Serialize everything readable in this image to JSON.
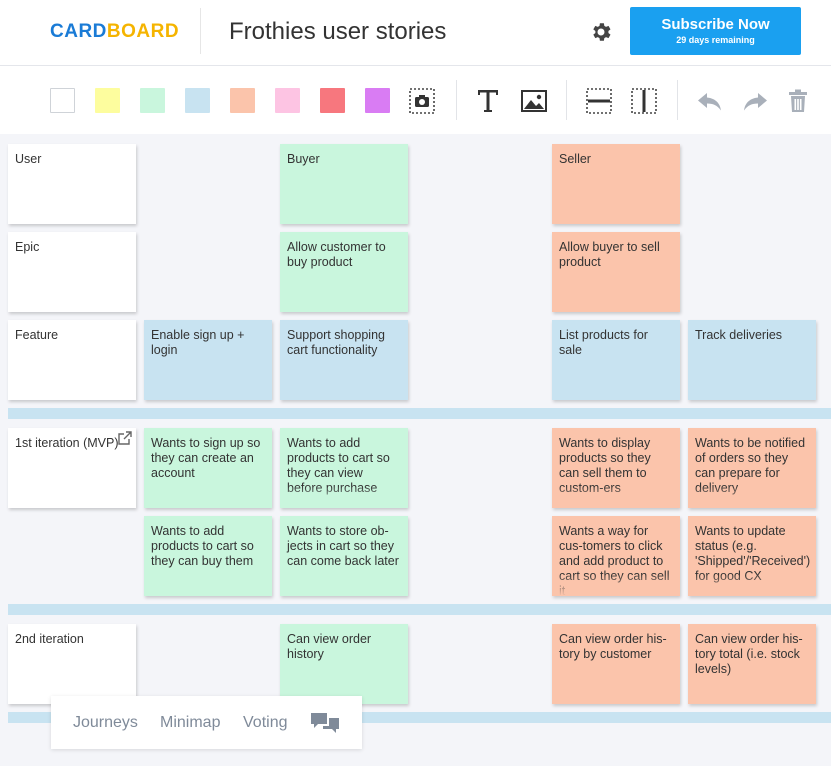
{
  "app": {
    "logo_part1": "CARD",
    "logo_part2": "BOARD",
    "board_title": "Frothies user stories",
    "subscribe_label": "Subscribe Now",
    "subscribe_sub": "29 days remaining",
    "icons": {
      "settings": "gear-icon"
    }
  },
  "toolbar": {
    "colors": [
      "#ffffff",
      "#fdfd9e",
      "#c9f6dd",
      "#c8e3f1",
      "#fbc4ab",
      "#fdc4e3",
      "#f7777e",
      "#d97cf3"
    ],
    "icons": [
      "camera-icon",
      "text-icon",
      "image-icon",
      "horizontal-divider-icon",
      "vertical-divider-icon",
      "undo-icon",
      "redo-icon",
      "trash-icon"
    ]
  },
  "board": {
    "row_labels": {
      "user": "User",
      "epic": "Epic",
      "feature": "Feature",
      "iteration1": "1st iteration (MVP)",
      "iteration2": "2nd iteration"
    },
    "cards": {
      "buyer": "Buyer",
      "seller": "Seller",
      "epic_buyer": "Allow customer to buy product",
      "epic_seller": "Allow buyer to sell product",
      "feat_signup": "Enable sign up + login",
      "feat_cart": "Support shopping cart functionality",
      "feat_list": "List products for sale",
      "feat_track": "Track deliveries",
      "s1_signup": "Wants to sign up so they can create an account",
      "s1_add": "Wants to add products to cart so they can view before purchase",
      "s1_display": "Wants to display products so they can sell them to custom-ers",
      "s1_notify": "Wants to be notified of orders so they can prepare for delivery",
      "s2_addcart": "Wants to add products to cart so they can buy them",
      "s2_store": "Wants to store ob-jects in cart so they can come back later",
      "s2_click": "Wants a way for cus-tomers to click and add product to cart so they can sell it",
      "s2_status": "Wants to update status (e.g. 'Shipped'/'Received') for good CX",
      "it2_buyer": "Can view order history",
      "it2_seller": "Can view order his-tory by customer",
      "it2_total": "Can view order his-tory total (i.e. stock levels)"
    }
  },
  "bottombar": {
    "journeys": "Journeys",
    "minimap": "Minimap",
    "voting": "Voting",
    "icons": {
      "comments": "comments-icon"
    }
  }
}
